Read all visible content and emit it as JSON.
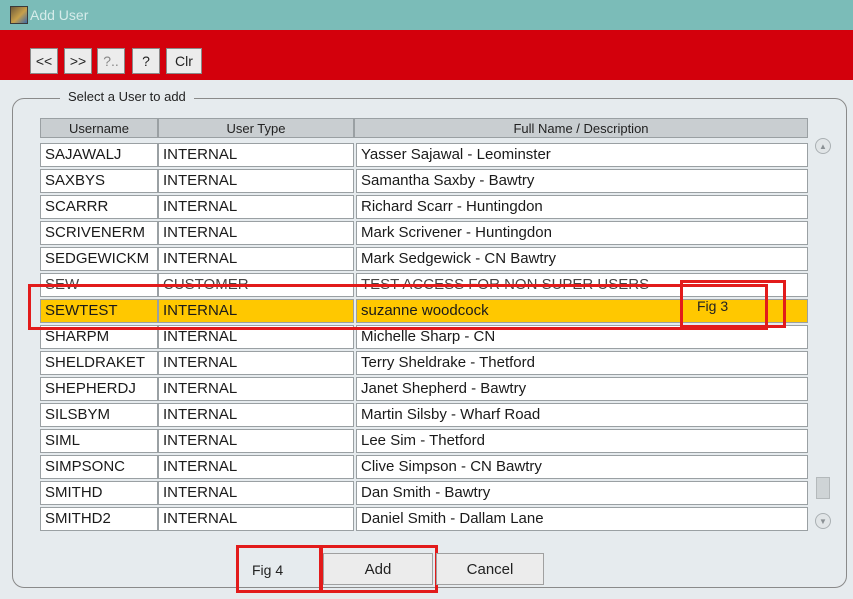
{
  "window": {
    "title": "Add User"
  },
  "toolbar": {
    "buttons": [
      {
        "label": "<<"
      },
      {
        "label": ">>"
      },
      {
        "label": "?.."
      },
      {
        "label": "?"
      },
      {
        "label": "Clr"
      }
    ]
  },
  "group": {
    "legend": "Select a User to add"
  },
  "table": {
    "columns": [
      "Username",
      "User Type",
      "Full Name /  Description"
    ],
    "rows": [
      [
        "SAJAWALJ",
        "INTERNAL",
        "Yasser Sajawal - Leominster"
      ],
      [
        "SAXBYS",
        "INTERNAL",
        "Samantha Saxby - Bawtry"
      ],
      [
        "SCARRR",
        "INTERNAL",
        "Richard Scarr - Huntingdon"
      ],
      [
        "SCRIVENERM",
        "INTERNAL",
        "Mark Scrivener - Huntingdon"
      ],
      [
        "SEDGEWICKM",
        "INTERNAL",
        "Mark Sedgewick - CN Bawtry"
      ],
      [
        "SEW",
        "CUSTOMER",
        "TEST ACCESS FOR NON SUPER USERS"
      ],
      [
        "SEWTEST",
        "INTERNAL",
        "suzanne woodcock"
      ],
      [
        "SHARPM",
        "INTERNAL",
        "Michelle Sharp - CN"
      ],
      [
        "SHELDRAKET",
        "INTERNAL",
        "Terry Sheldrake - Thetford"
      ],
      [
        "SHEPHERDJ",
        "INTERNAL",
        "Janet Shepherd - Bawtry"
      ],
      [
        "SILSBYM",
        "INTERNAL",
        "Martin Silsby - Wharf Road"
      ],
      [
        "SIML",
        "INTERNAL",
        "Lee Sim - Thetford"
      ],
      [
        "SIMPSONC",
        "INTERNAL",
        "Clive Simpson - CN Bawtry"
      ],
      [
        "SMITHD",
        "INTERNAL",
        "Dan Smith - Bawtry"
      ],
      [
        "SMITHD2",
        "INTERNAL",
        "Daniel Smith - Dallam Lane"
      ]
    ],
    "selected_row": 6
  },
  "annotations": {
    "fig3": "Fig 3",
    "fig4": "Fig 4"
  },
  "buttons": {
    "add": "Add",
    "cancel": "Cancel"
  },
  "colors": {
    "titlebar": "#7bbcb8",
    "toolbar": "#d3000c",
    "selection": "#ffc800",
    "annotation": "#e21b1b"
  }
}
